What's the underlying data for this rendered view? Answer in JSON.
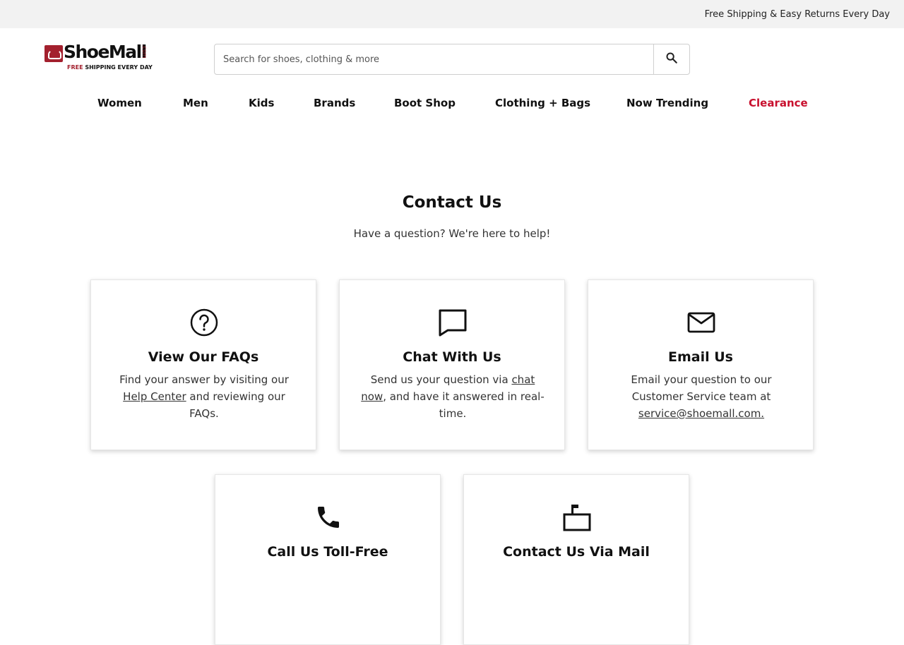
{
  "promo": {
    "text": "Free Shipping & Easy Returns Every Day"
  },
  "logo": {
    "name": "ShoeMall",
    "com": ".com",
    "tag_free": "FREE",
    "tag_rest": " SHIPPING EVERY DAY"
  },
  "search": {
    "placeholder": "Search for shoes, clothing & more",
    "value": "",
    "button_icon": "search-icon"
  },
  "nav": {
    "items": [
      {
        "label": "Women"
      },
      {
        "label": "Men"
      },
      {
        "label": "Kids"
      },
      {
        "label": "Brands"
      },
      {
        "label": "Boot Shop"
      },
      {
        "label": "Clothing + Bags"
      },
      {
        "label": "Now Trending"
      },
      {
        "label": "Clearance"
      }
    ]
  },
  "hero": {
    "title": "Contact Us",
    "subtitle": "Have a question? We're here to help!"
  },
  "cards": [
    {
      "icon": "question-circle-icon",
      "title": "View Our FAQs",
      "text_before": "Find your answer by visiting our ",
      "link": "Help Center",
      "text_after": " and reviewing our FAQs."
    },
    {
      "icon": "chat-icon",
      "title": "Chat With Us",
      "text_before": "Send us your question via ",
      "link": "chat now",
      "text_after": ", and have it answered in real-time."
    },
    {
      "icon": "mail-icon",
      "title": "Email Us",
      "text_before": "Email your question to our Customer Service team at ",
      "link": "service@shoemall.com.",
      "text_after": ""
    },
    {
      "icon": "phone-icon",
      "title": "Call Us Toll-Free"
    },
    {
      "icon": "mailbox-icon",
      "title": "Contact Us Via Mail"
    }
  ],
  "colors": {
    "brand": "#a3202e",
    "clearance": "#c8102e",
    "promo_bg": "#f2f2f2"
  }
}
